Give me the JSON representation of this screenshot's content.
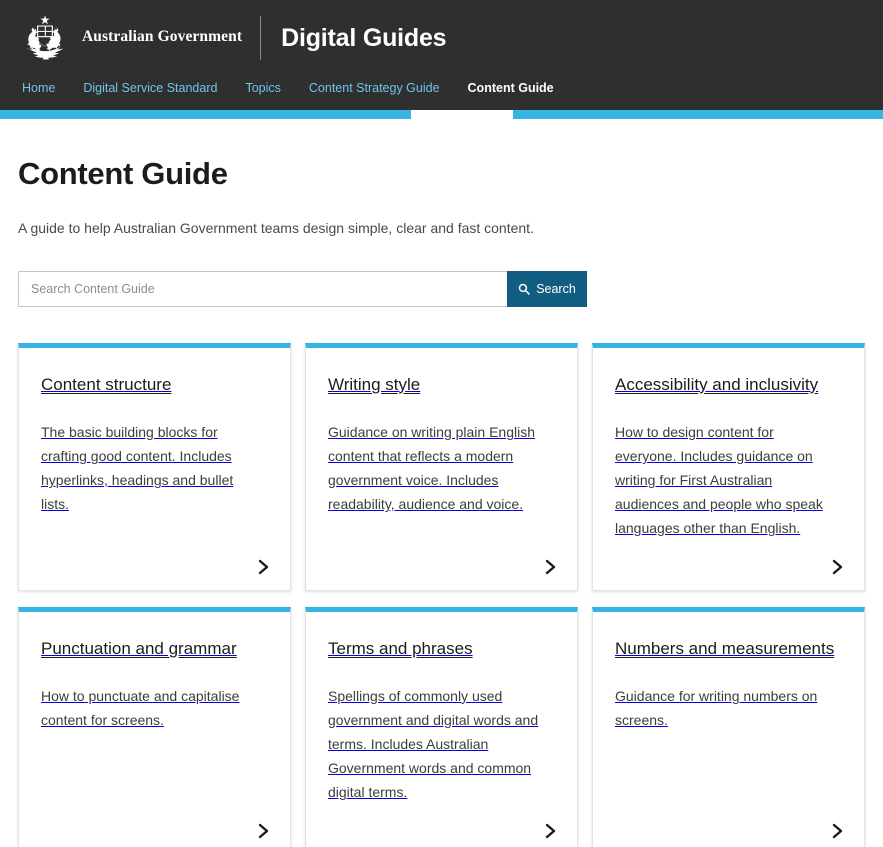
{
  "masthead": {
    "crest_icon": "australian-coat-of-arms",
    "government_wordmark": "Australian Government",
    "site_title": "Digital Guides",
    "accent_color": "#36b5e5",
    "background_color": "#2f2f2f"
  },
  "nav": {
    "items": [
      {
        "label": "Home",
        "active": false
      },
      {
        "label": "Digital Service Standard",
        "active": false
      },
      {
        "label": "Topics",
        "active": false
      },
      {
        "label": "Content Strategy Guide",
        "active": false
      },
      {
        "label": "Content Guide",
        "active": true
      }
    ]
  },
  "page": {
    "title": "Content Guide",
    "intro": "A guide to help Australian Government teams design simple, clear and fast content."
  },
  "search": {
    "placeholder": "Search Content Guide",
    "value": "",
    "button_label": "Search",
    "button_icon": "search-icon",
    "button_color": "#125e82"
  },
  "cards": [
    {
      "title": "Content structure",
      "description": "The basic building blocks for crafting good content. Includes hyperlinks, headings and bullet lists.",
      "arrow_icon": "chevron-right-icon"
    },
    {
      "title": "Writing style",
      "description": "Guidance on writing plain English content that reflects a modern government voice. Includes readability, audience and voice.",
      "arrow_icon": "chevron-right-icon"
    },
    {
      "title": "Accessibility and inclusivity",
      "description": "How to design content for everyone. Includes guidance on writing for First Australian audiences and people who speak languages other than English.",
      "arrow_icon": "chevron-right-icon"
    },
    {
      "title": "Punctuation and grammar",
      "description": "How to punctuate and capitalise content for screens.",
      "arrow_icon": "chevron-right-icon"
    },
    {
      "title": "Terms and phrases",
      "description": "Spellings of commonly used government and digital words and terms. Includes Australian Government words and common digital terms.",
      "arrow_icon": "chevron-right-icon"
    },
    {
      "title": "Numbers and measurements",
      "description": "Guidance for writing numbers on screens.",
      "arrow_icon": "chevron-right-icon"
    }
  ]
}
